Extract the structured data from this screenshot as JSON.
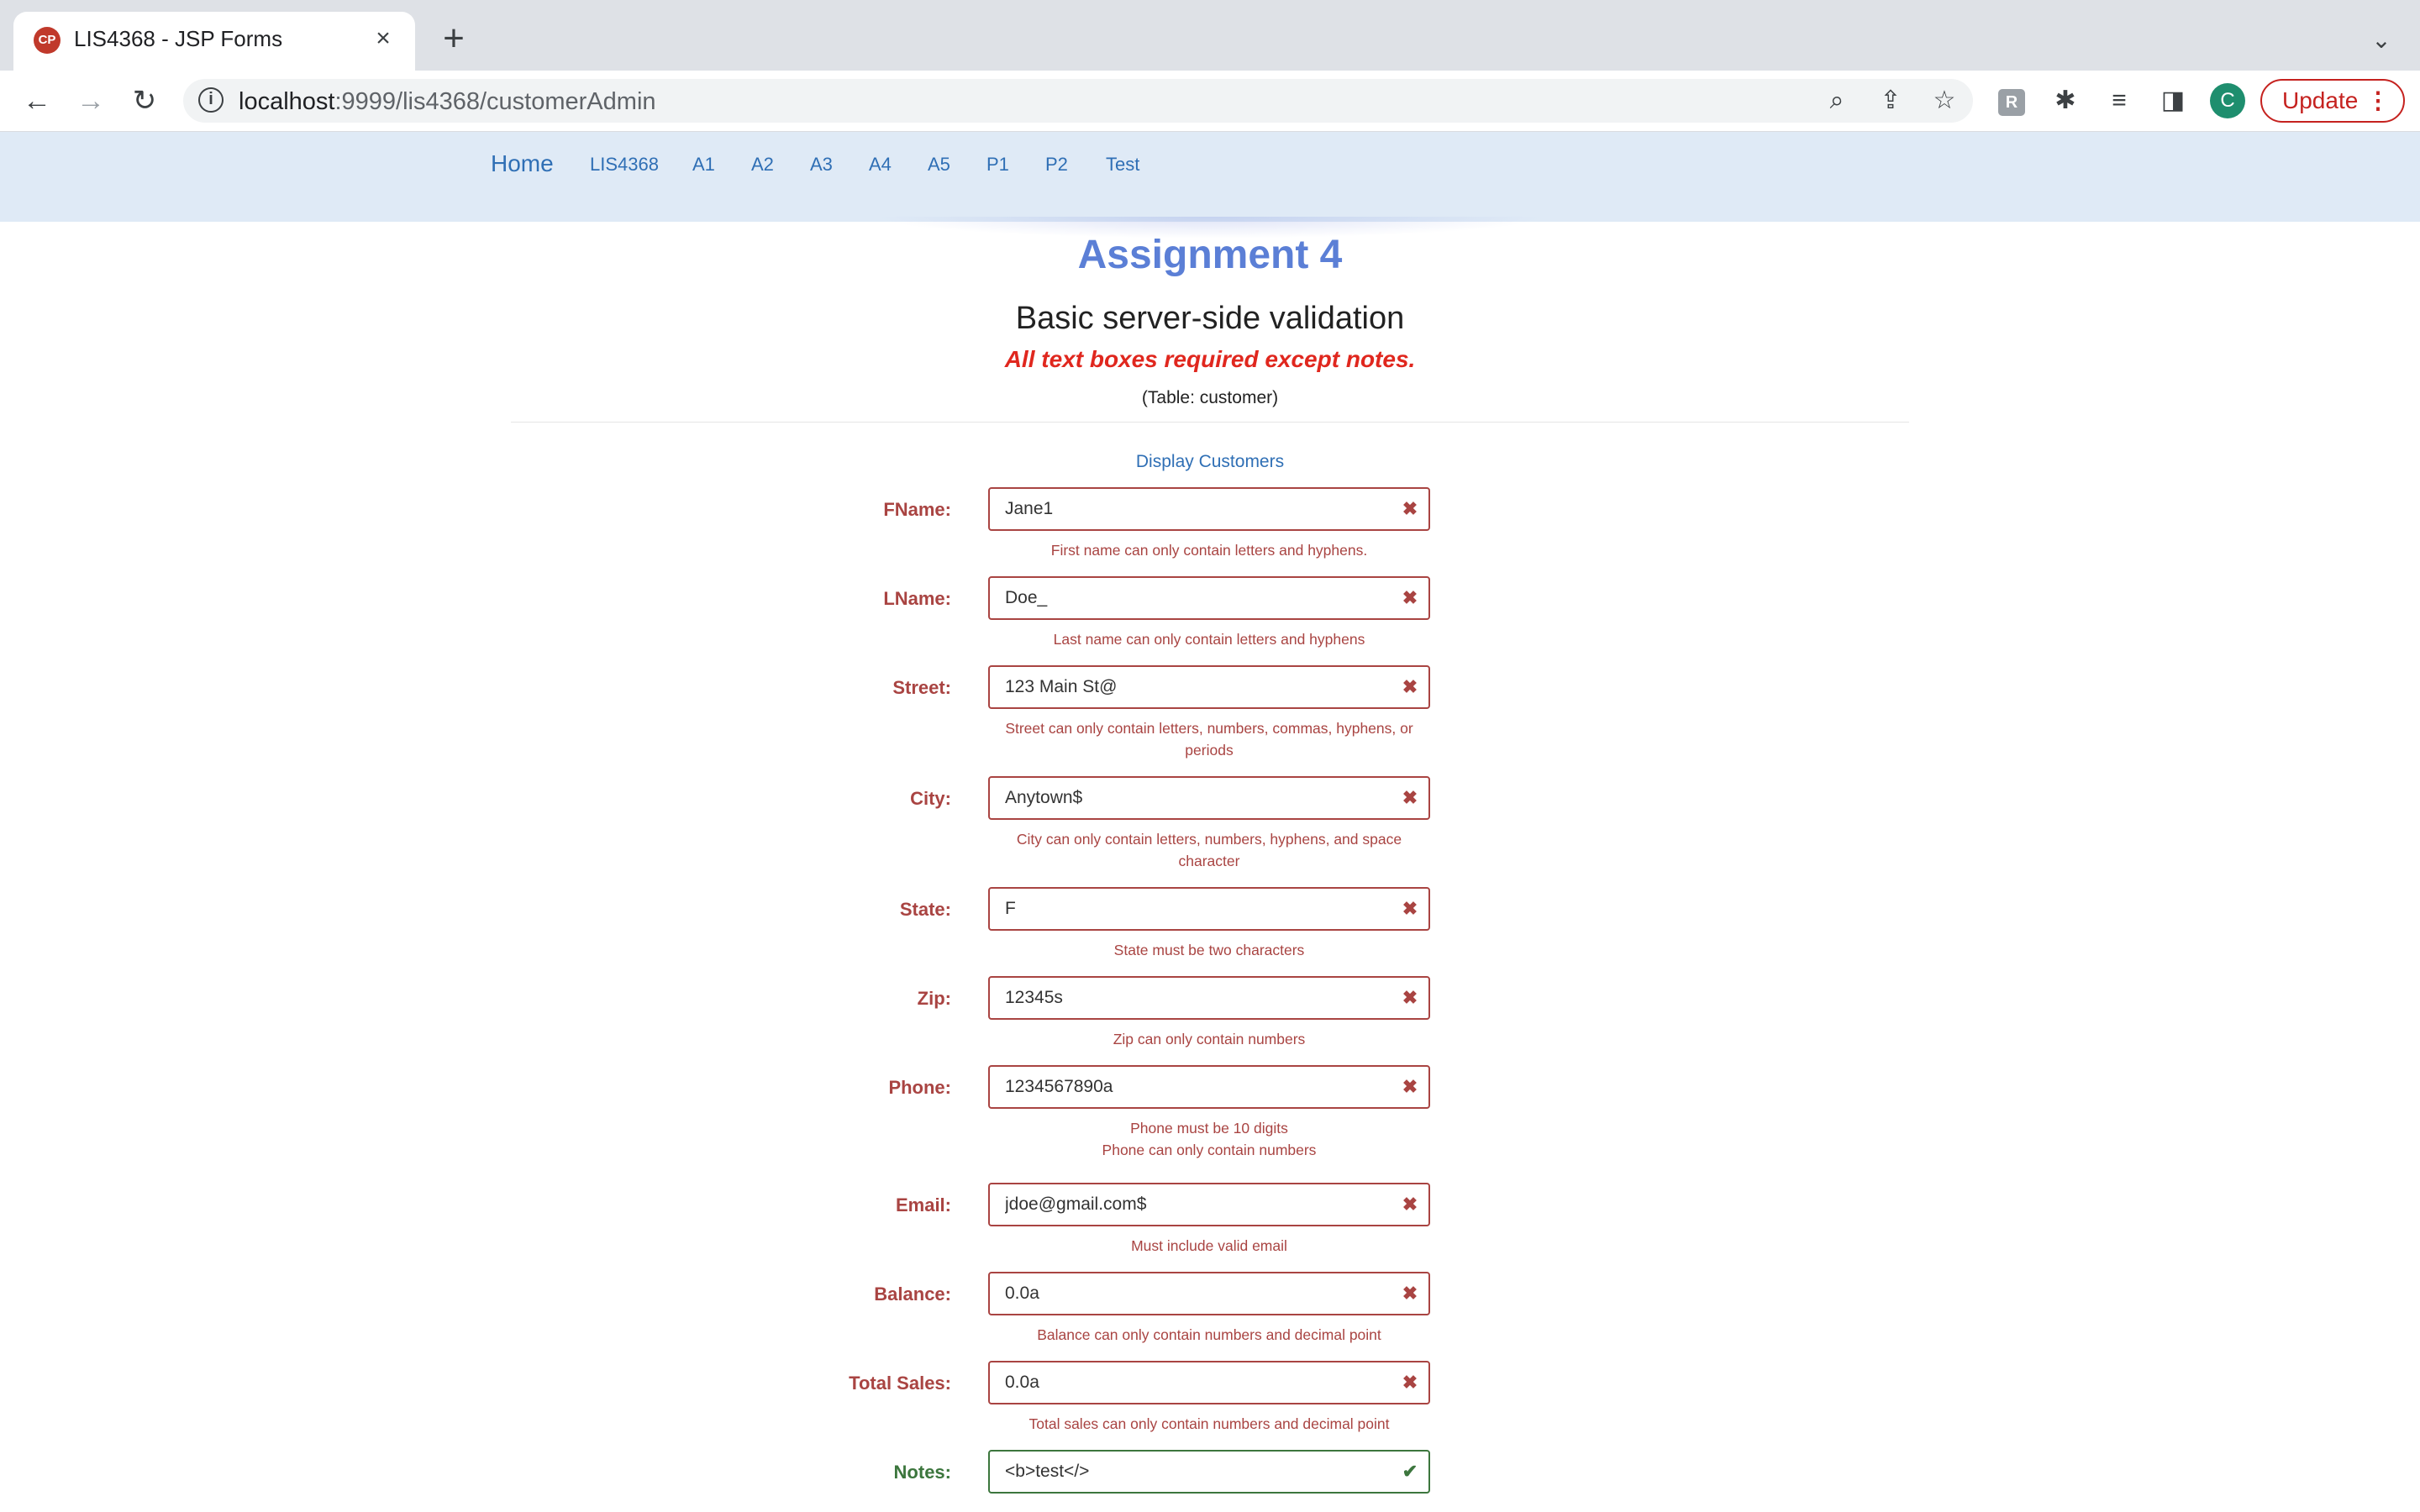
{
  "browser": {
    "tab_title": "LIS4368 - JSP Forms",
    "favicon_text": "CP",
    "url_host": "localhost",
    "url_rest": ":9999/lis4368/customerAdmin",
    "profile_initial": "C",
    "update_label": "Update",
    "accent_color": "#c5221f"
  },
  "nav": {
    "home": "Home",
    "items": [
      "LIS4368",
      "A1",
      "A2",
      "A3",
      "A4",
      "A5",
      "P1",
      "P2",
      "Test"
    ]
  },
  "page": {
    "title": "Assignment 4",
    "subtitle": "Basic server-side validation",
    "required_note": "All text boxes required except notes.",
    "table_note": "(Table: customer)",
    "display_link": "Display Customers"
  },
  "form": {
    "fields": [
      {
        "label": "FName:",
        "value": "Jane1",
        "status": "error",
        "errors": [
          "First name can only contain letters and hyphens."
        ]
      },
      {
        "label": "LName:",
        "value": "Doe_",
        "status": "error",
        "errors": [
          "Last name can only contain letters and hyphens"
        ]
      },
      {
        "label": "Street:",
        "value": "123 Main St@",
        "status": "error",
        "errors": [
          "Street can only contain letters, numbers, commas, hyphens, or",
          "periods"
        ]
      },
      {
        "label": "City:",
        "value": "Anytown$",
        "status": "error",
        "errors": [
          "City can only contain letters, numbers, hyphens, and space",
          "character"
        ]
      },
      {
        "label": "State:",
        "value": "F",
        "status": "error",
        "errors": [
          "State must be two characters"
        ]
      },
      {
        "label": "Zip:",
        "value": "12345s",
        "status": "error",
        "errors": [
          "Zip can only contain numbers"
        ]
      },
      {
        "label": "Phone:",
        "value": "1234567890a",
        "status": "error",
        "errors": [
          "Phone must be 10 digits",
          "Phone can only contain numbers"
        ]
      },
      {
        "label": "Email:",
        "value": "jdoe@gmail.com$",
        "status": "error",
        "errors": [
          "Must include valid email"
        ]
      },
      {
        "label": "Balance:",
        "value": "0.0a",
        "status": "error",
        "errors": [
          "Balance can only contain numbers and decimal point"
        ]
      },
      {
        "label": "Total Sales:",
        "value": "0.0a",
        "status": "error",
        "errors": [
          "Total sales can only contain numbers and decimal point"
        ]
      },
      {
        "label": "Notes:",
        "value": "<b>test</>",
        "status": "ok",
        "errors": []
      }
    ],
    "error_color": "#a94442",
    "success_color": "#3c763d"
  }
}
